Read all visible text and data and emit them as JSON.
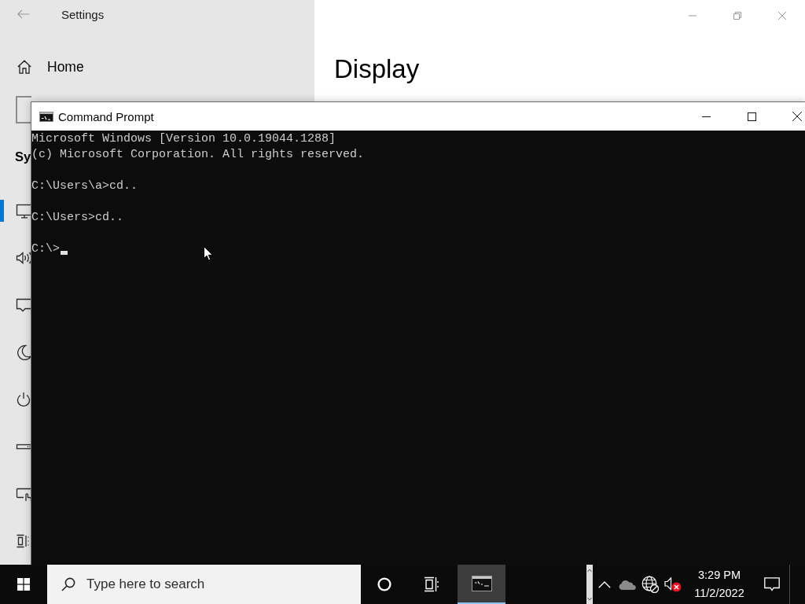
{
  "settings_window": {
    "title": "Settings",
    "home_label": "Home",
    "section_heading": "Sy",
    "nav_items": [
      {
        "kind": "display",
        "selected": true
      },
      {
        "kind": "sound",
        "selected": false
      },
      {
        "kind": "notifications",
        "selected": false
      },
      {
        "kind": "focus",
        "selected": false
      },
      {
        "kind": "power",
        "selected": false
      },
      {
        "kind": "storage",
        "selected": false
      },
      {
        "kind": "tablet",
        "selected": false
      },
      {
        "kind": "multitasking",
        "selected": false
      }
    ],
    "page_title": "Display"
  },
  "command_prompt": {
    "title": "Command Prompt",
    "blocks": [
      [
        "Microsoft Windows [Version 10.0.19044.1288]",
        "(c) Microsoft Corporation. All rights reserved."
      ],
      [
        "C:\\Users\\a>cd.."
      ],
      [
        "C:\\Users>cd.."
      ],
      [
        "C:\\>"
      ]
    ],
    "cursor_visible": true
  },
  "taskbar": {
    "search": {
      "placeholder": "Type here to search"
    },
    "running_apps": [
      {
        "kind": "console",
        "selected": true
      }
    ],
    "tray": {
      "network_connected": false,
      "volume_muted": true,
      "time": "3:29 PM",
      "date": "11/2/2022"
    }
  }
}
